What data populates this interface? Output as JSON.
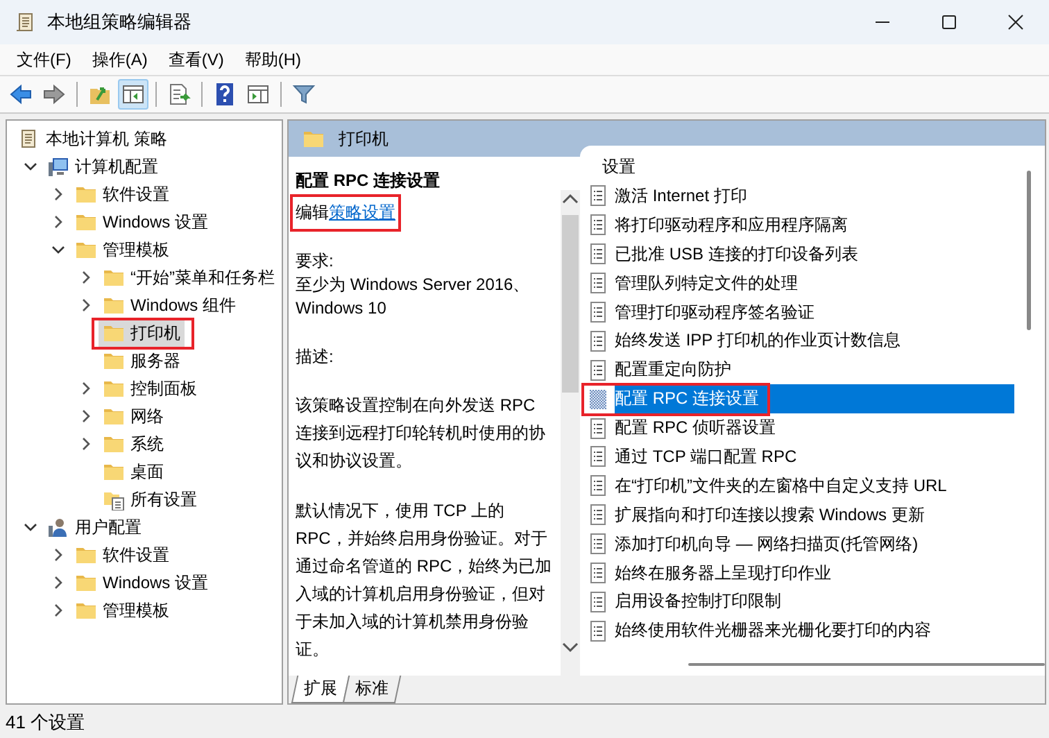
{
  "window": {
    "title": "本地组策略编辑器"
  },
  "menu": [
    "文件(F)",
    "操作(A)",
    "查看(V)",
    "帮助(H)"
  ],
  "toolbar": [
    {
      "kind": "back",
      "pressed": false
    },
    {
      "kind": "forward",
      "pressed": false
    },
    {
      "kind": "separator"
    },
    {
      "kind": "folder-up",
      "pressed": false
    },
    {
      "kind": "tree-toggle",
      "pressed": true
    },
    {
      "kind": "separator"
    },
    {
      "kind": "export",
      "pressed": false
    },
    {
      "kind": "separator"
    },
    {
      "kind": "help",
      "pressed": false
    },
    {
      "kind": "action-pane",
      "pressed": false
    },
    {
      "kind": "separator"
    },
    {
      "kind": "filter",
      "pressed": false
    }
  ],
  "tree": {
    "label": "本地计算机 策略",
    "kind": "scroll",
    "selected": false,
    "highlighted": false,
    "children": [
      {
        "label": "计算机配置",
        "kind": "computer",
        "expanded": true,
        "selected": false,
        "highlighted": false,
        "children": [
          {
            "label": "软件设置",
            "kind": "folder",
            "expanded": false,
            "selected": false,
            "highlighted": false
          },
          {
            "label": "Windows 设置",
            "kind": "folder",
            "expanded": false,
            "selected": false,
            "highlighted": false
          },
          {
            "label": "管理模板",
            "kind": "folder",
            "expanded": true,
            "selected": false,
            "highlighted": false,
            "children": [
              {
                "label": "“开始”菜单和任务栏",
                "kind": "folder",
                "expanded": false,
                "selected": false,
                "highlighted": false
              },
              {
                "label": "Windows 组件",
                "kind": "folder",
                "expanded": false,
                "selected": false,
                "highlighted": false
              },
              {
                "label": "打印机",
                "kind": "folder",
                "selected": true,
                "highlighted": true
              },
              {
                "label": "服务器",
                "kind": "folder",
                "selected": false,
                "highlighted": false
              },
              {
                "label": "控制面板",
                "kind": "folder",
                "expanded": false,
                "selected": false,
                "highlighted": false
              },
              {
                "label": "网络",
                "kind": "folder",
                "expanded": false,
                "selected": false,
                "highlighted": false
              },
              {
                "label": "系统",
                "kind": "folder",
                "expanded": false,
                "selected": false,
                "highlighted": false
              },
              {
                "label": "桌面",
                "kind": "folder",
                "selected": false,
                "highlighted": false
              },
              {
                "label": "所有设置",
                "kind": "settings",
                "selected": false,
                "highlighted": false
              }
            ]
          }
        ]
      },
      {
        "label": "用户配置",
        "kind": "user",
        "expanded": true,
        "selected": false,
        "highlighted": false,
        "children": [
          {
            "label": "软件设置",
            "kind": "folder",
            "expanded": false,
            "selected": false,
            "highlighted": false
          },
          {
            "label": "Windows 设置",
            "kind": "folder",
            "expanded": false,
            "selected": false,
            "highlighted": false
          },
          {
            "label": "管理模板",
            "kind": "folder",
            "expanded": false,
            "selected": false,
            "highlighted": false
          }
        ]
      }
    ]
  },
  "pane_header": "打印机",
  "description": {
    "title": "配置 RPC 连接设置",
    "edit_prefix": "编辑",
    "edit_link": "策略设置",
    "highlighted": true,
    "requirements_label": "要求:",
    "requirements": "至少为 Windows Server 2016、Windows 10",
    "description_label": "描述:",
    "paragraphs": [
      "该策略设置控制在向外发送 RPC 连接到远程打印轮转机时使用的协议和协议设置。",
      "默认情况下，使用 TCP 上的 RPC，并始终启用身份验证。对于通过命名管道的 RPC，始终为已加入域的计算机启用身份验证，但对于未加入域的计算机禁用身份验证。"
    ]
  },
  "settings": {
    "header": "设置",
    "items": [
      {
        "label": "激活 Internet 打印",
        "selected": false,
        "highlighted": false
      },
      {
        "label": "将打印驱动程序和应用程序隔离",
        "selected": false,
        "highlighted": false
      },
      {
        "label": "已批准 USB 连接的打印设备列表",
        "selected": false,
        "highlighted": false
      },
      {
        "label": "管理队列特定文件的处理",
        "selected": false,
        "highlighted": false
      },
      {
        "label": "管理打印驱动程序签名验证",
        "selected": false,
        "highlighted": false
      },
      {
        "label": "始终发送 IPP 打印机的作业页计数信息",
        "selected": false,
        "highlighted": false
      },
      {
        "label": "配置重定向防护",
        "selected": false,
        "highlighted": false
      },
      {
        "label": "配置 RPC 连接设置",
        "selected": true,
        "highlighted": true
      },
      {
        "label": "配置 RPC 侦听器设置",
        "selected": false,
        "highlighted": false
      },
      {
        "label": "通过 TCP 端口配置 RPC",
        "selected": false,
        "highlighted": false
      },
      {
        "label": "在“打印机”文件夹的左窗格中自定义支持 URL",
        "selected": false,
        "highlighted": false
      },
      {
        "label": "扩展指向和打印连接以搜索 Windows 更新",
        "selected": false,
        "highlighted": false
      },
      {
        "label": "添加打印机向导 — 网络扫描页(托管网络)",
        "selected": false,
        "highlighted": false
      },
      {
        "label": "始终在服务器上呈现打印作业",
        "selected": false,
        "highlighted": false
      },
      {
        "label": "启用设备控制打印限制",
        "selected": false,
        "highlighted": false
      },
      {
        "label": "始终使用软件光栅器来光栅化要打印的内容",
        "selected": false,
        "highlighted": false
      }
    ]
  },
  "tabs": [
    {
      "label": "扩展",
      "selected": true
    },
    {
      "label": "标准",
      "selected": false
    }
  ],
  "status_bar": "41 个设置"
}
